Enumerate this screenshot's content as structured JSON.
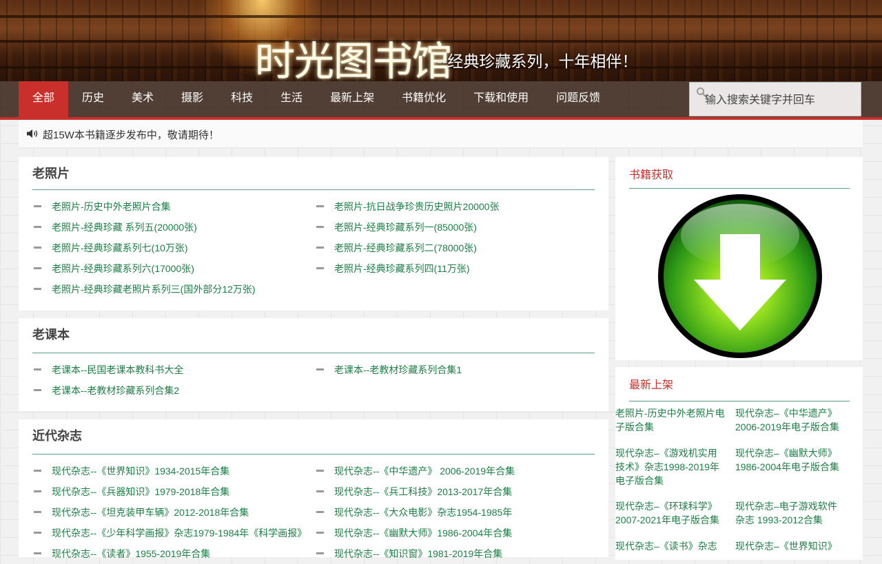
{
  "header": {
    "title": "时光图书馆",
    "subtitle": "--经典珍藏系列，十年相伴！"
  },
  "nav": {
    "items": [
      "全部",
      "历史",
      "美术",
      "摄影",
      "科技",
      "生活",
      "最新上架",
      "书籍优化",
      "下载和使用",
      "问题反馈"
    ],
    "active_index": 0
  },
  "search": {
    "placeholder": "输入搜索关键字并回车",
    "icon": "search-icon"
  },
  "notice": {
    "icon": "speaker-icon",
    "text": "超15W本书籍逐步发布中，敬请期待！"
  },
  "sections": [
    {
      "title": "老照片",
      "links": [
        "老照片-历史中外老照片合集",
        "老照片-抗日战争珍贵历史照片20000张",
        "老照片-经典珍藏 系列五(20000张)",
        "老照片-经典珍藏系列一(85000张)",
        "老照片-经典珍藏系列七(10万张)",
        "老照片-经典珍藏系列二(78000张)",
        "老照片-经典珍藏系列六(17000张)",
        "老照片-经典珍藏系列四(11万张)",
        "老照片-经典珍藏老照片系列三(国外部分12万张)"
      ]
    },
    {
      "title": "老课本",
      "links": [
        "老课本--民国老课本教科书大全",
        "老课本--老教材珍藏系列合集1",
        "老课本--老教材珍藏系列合集2"
      ]
    },
    {
      "title": "近代杂志",
      "links": [
        "现代杂志--《世界知识》1934-2015年合集",
        "现代杂志--《中华遗产》 2006-2019年合集",
        "现代杂志--《兵器知识》1979-2018年合集",
        "现代杂志--《兵工科技》2013-2017年合集",
        "现代杂志--《坦克装甲车辆》2012-2018年合集",
        "现代杂志--《大众电影》杂志1954-1985年",
        "现代杂志--《少年科学画报》杂志1979-1984年《科学画报》",
        "现代杂志--《幽默大师》1986-2004年合集",
        "现代杂志--《读者》1955-2019年合集",
        "现代杂志--《知识窗》1981-2019年合集"
      ]
    }
  ],
  "sidebar": {
    "download_title": "书籍获取",
    "download_icon": "download-arrow-icon",
    "newest_title": "最新上架",
    "newest_items": [
      "老照片-历史中外老照片电子版合集",
      "现代杂志–《中华遗产》2006-2019年电子版合集",
      "现代杂志–《游戏机实用技术》杂志1998-2019年电子版合集",
      "现代杂志–《幽默大师》1986-2004年电子版合集",
      "现代杂志–《环球科学》2007-2021年电子版合集",
      "现代杂志–电子游戏软件杂志 1993-2012合集",
      "现代杂志–《读书》杂志",
      "现代杂志–《世界知识》"
    ]
  },
  "colors": {
    "accent": "#c9302c",
    "link": "#1c7f45",
    "rule": "#5b9a87"
  }
}
